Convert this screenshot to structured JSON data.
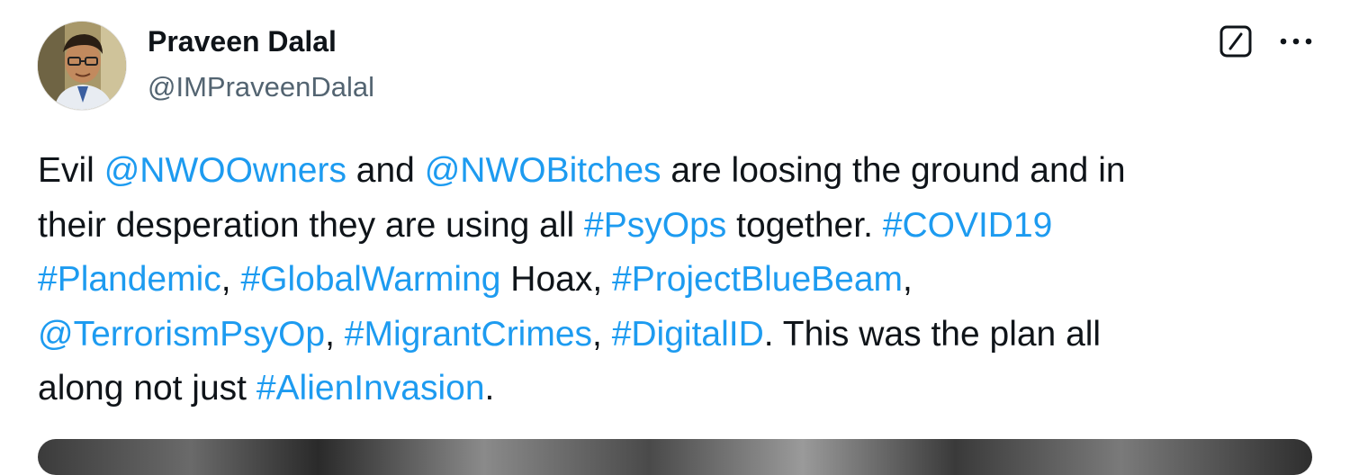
{
  "author": {
    "display_name": "Praveen Dalal",
    "handle": "@IMPraveenDalal",
    "avatar_icon": "profile-photo"
  },
  "actions": {
    "grok_icon": "grok-icon",
    "more_icon": "more-horizontal-icon"
  },
  "tweet": {
    "lines": [
      [
        {
          "text": "Evil ",
          "type": "text"
        },
        {
          "text": "@NWOOwners",
          "type": "mention"
        },
        {
          "text": " and ",
          "type": "text"
        },
        {
          "text": "@NWOBitches",
          "type": "mention"
        },
        {
          "text": " are loosing the ground and in",
          "type": "text"
        }
      ],
      [
        {
          "text": "their desperation they are using all ",
          "type": "text"
        },
        {
          "text": "#PsyOps",
          "type": "hashtag"
        },
        {
          "text": " together. ",
          "type": "text"
        },
        {
          "text": "#COVID19",
          "type": "hashtag"
        }
      ],
      [
        {
          "text": "#Plandemic",
          "type": "hashtag"
        },
        {
          "text": ", ",
          "type": "text"
        },
        {
          "text": "#GlobalWarming",
          "type": "hashtag"
        },
        {
          "text": " Hoax, ",
          "type": "text"
        },
        {
          "text": "#ProjectBlueBeam",
          "type": "hashtag"
        },
        {
          "text": ",",
          "type": "text"
        }
      ],
      [
        {
          "text": "@TerrorismPsyOp",
          "type": "mention"
        },
        {
          "text": ", ",
          "type": "text"
        },
        {
          "text": "#MigrantCrimes",
          "type": "hashtag"
        },
        {
          "text": ", ",
          "type": "text"
        },
        {
          "text": "#DigitalID",
          "type": "hashtag"
        },
        {
          "text": ". This was the plan all",
          "type": "text"
        }
      ],
      [
        {
          "text": "along not just ",
          "type": "text"
        },
        {
          "text": "#AlienInvasion",
          "type": "hashtag"
        },
        {
          "text": ".",
          "type": "text"
        }
      ]
    ]
  },
  "colors": {
    "link": "#1d9bf0",
    "text": "#0f1419",
    "secondary": "#536471"
  }
}
